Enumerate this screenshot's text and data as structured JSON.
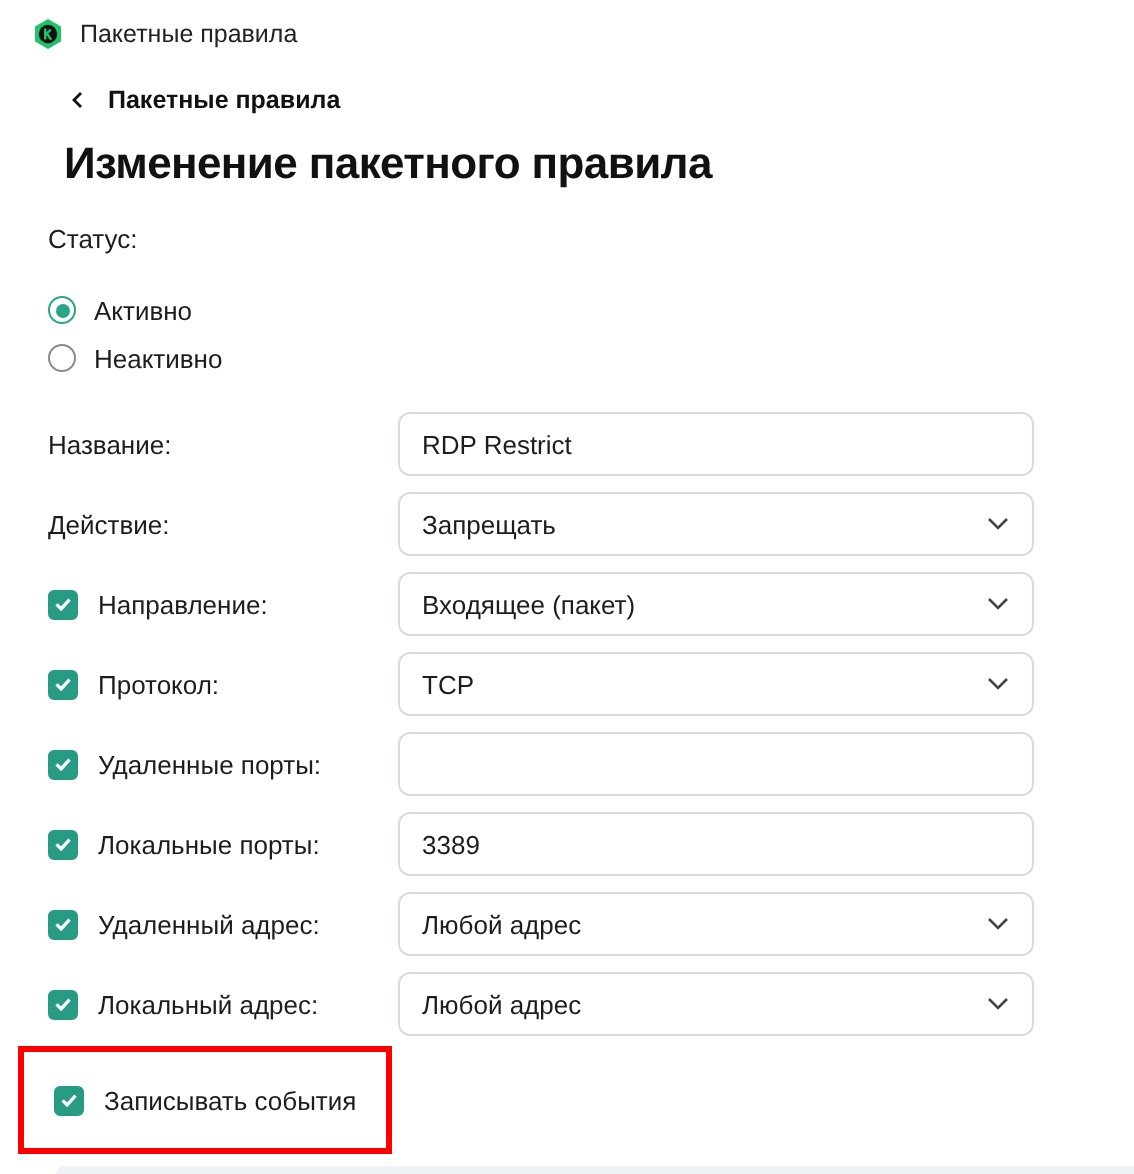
{
  "window": {
    "title": "Пакетные правила"
  },
  "breadcrumb": {
    "label": "Пакетные правила"
  },
  "heading": "Изменение пакетного правила",
  "status": {
    "label": "Статус:",
    "options": [
      {
        "label": "Активно",
        "selected": true
      },
      {
        "label": "Неактивно",
        "selected": false
      }
    ]
  },
  "fields": [
    {
      "label": "Название:",
      "kind": "input",
      "value": "RDP Restrict"
    },
    {
      "label": "Действие:",
      "kind": "select",
      "value": "Запрещать"
    },
    {
      "label": "Направление:",
      "kind": "select",
      "value": "Входящее (пакет)",
      "checked": true
    },
    {
      "label": "Протокол:",
      "kind": "select",
      "value": "TCP",
      "checked": true
    },
    {
      "label": "Удаленные порты:",
      "kind": "input",
      "checked": true
    },
    {
      "label": "Локальные порты:",
      "kind": "input",
      "value": "3389",
      "checked": true
    },
    {
      "label": "Удаленный адрес:",
      "kind": "select",
      "value": "Любой адрес",
      "checked": true
    },
    {
      "label": "Локальный адрес:",
      "kind": "select",
      "value": "Любой адрес",
      "checked": true
    }
  ],
  "log_events": {
    "label": "Записывать события",
    "checked": true,
    "highlighted": true
  }
}
